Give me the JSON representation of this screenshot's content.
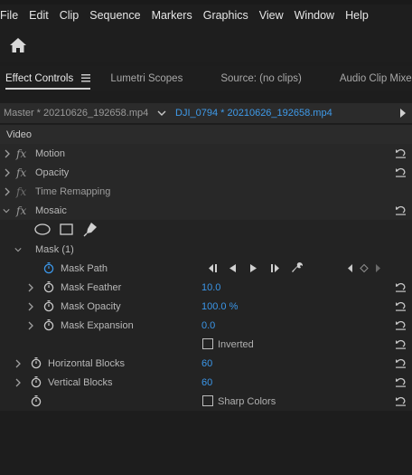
{
  "menu": [
    "File",
    "Edit",
    "Clip",
    "Sequence",
    "Markers",
    "Graphics",
    "View",
    "Window",
    "Help"
  ],
  "panel_tabs": {
    "effect_controls": "Effect Controls",
    "lumetri": "Lumetri Scopes",
    "source": "Source: (no clips)",
    "audio_mixer": "Audio Clip Mixer: D"
  },
  "sequence_bar": {
    "master": "Master * 20210626_192658.mp4",
    "clip": "DJI_0794 * 20210626_192658.mp4"
  },
  "section_video": "Video",
  "effects": {
    "motion": "Motion",
    "opacity": "Opacity",
    "time_remapping": "Time Remapping",
    "mosaic": "Mosaic"
  },
  "mask": {
    "label": "Mask (1)",
    "path": "Mask Path",
    "feather": {
      "label": "Mask Feather",
      "value": "10.0"
    },
    "opacity": {
      "label": "Mask Opacity",
      "value": "100.0",
      "unit": "%"
    },
    "expansion": {
      "label": "Mask Expansion",
      "value": "0.0"
    },
    "inverted": "Inverted"
  },
  "blocks": {
    "horizontal": {
      "label": "Horizontal Blocks",
      "value": "60"
    },
    "vertical": {
      "label": "Vertical Blocks",
      "value": "60"
    },
    "sharp_colors": "Sharp Colors"
  },
  "colors": {
    "accent": "#3b96e8",
    "panel": "#1d1d1d"
  }
}
